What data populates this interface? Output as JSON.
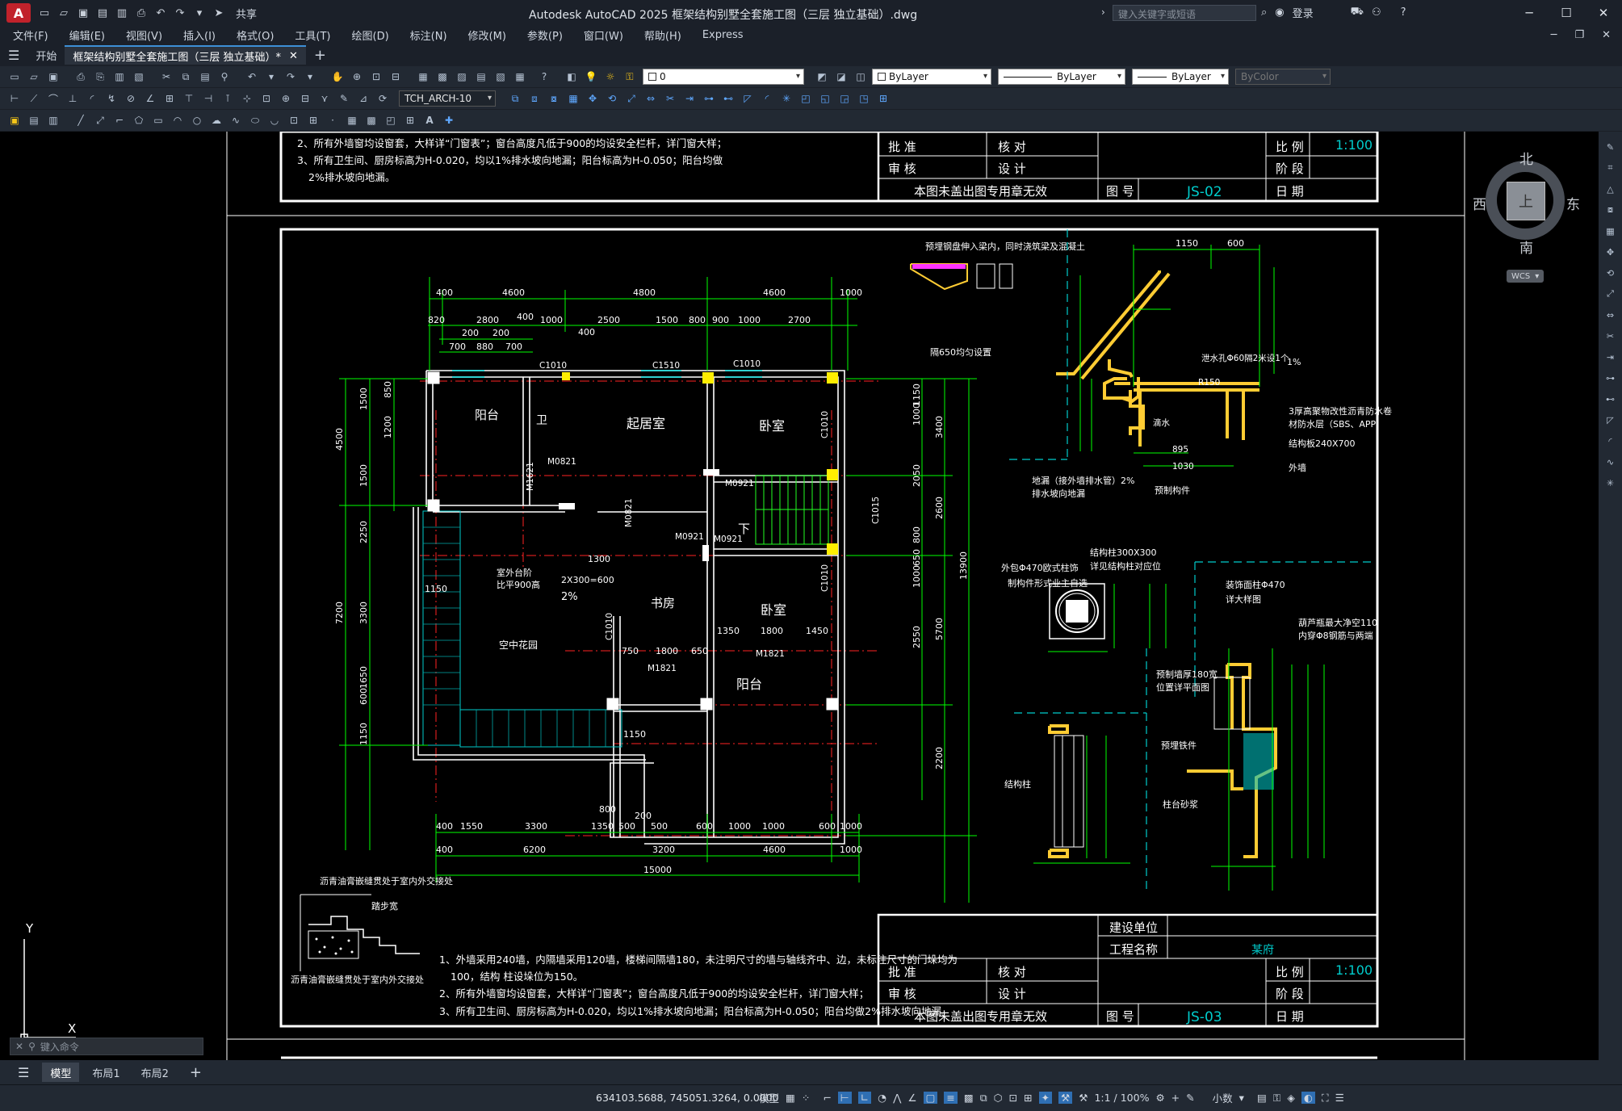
{
  "title_bar": {
    "app_button": "A",
    "share_label": "共享",
    "window_title": "Autodesk AutoCAD 2025    框架结构别墅全套施工图（三层 独立基础）.dwg",
    "search_placeholder": "键入关键字或短语",
    "login_label": "登录"
  },
  "menu": {
    "items": [
      "文件(F)",
      "编辑(E)",
      "视图(V)",
      "插入(I)",
      "格式(O)",
      "工具(T)",
      "绘图(D)",
      "标注(N)",
      "修改(M)",
      "参数(P)",
      "窗口(W)",
      "帮助(H)",
      "Express"
    ]
  },
  "tabs": {
    "start": "开始",
    "doc": "框架结构别墅全套施工图（三层 独立基础）*"
  },
  "toolbar": {
    "layer_value": "0",
    "color_value": "ByLayer",
    "linetype_value": "ByLayer",
    "lineweight_value": "ByLayer",
    "plotstyle_value": "ByColor",
    "textstyle_value": "TCH_ARCH-10"
  },
  "viewcube": {
    "north": "北",
    "south": "南",
    "east": "东",
    "west": "西",
    "face": "上",
    "wcs": "WCS"
  },
  "drawing": {
    "notes_top": [
      "2、所有外墙窗均设窗套，大样详“门窗表”；窗台高度凡低于900的均设安全栏杆，详门窗大样；",
      "3、所有卫生间、厨房标高为H-0.020，均以1%排水坡向地漏；阳台标高为H-0.050；阳台均做",
      "2%排水坡向地漏。"
    ],
    "title_block_top": {
      "approve": "批  准",
      "check": "核  对",
      "review": "审  核",
      "design": "设  计",
      "scale_label": "比  例",
      "scale": "1:100",
      "stage_label": "阶  段",
      "stamp_note": "本图未盖出图专用章无效",
      "drawing_no_label": "图  号",
      "drawing_no": "JS-02",
      "date_label": "日  期"
    },
    "title_block_bottom": {
      "owner_label": "建设单位",
      "project_label": "工程名称",
      "project": "某府",
      "approve": "批  准",
      "check": "核  对",
      "review": "审  核",
      "design": "设  计",
      "scale_label": "比  例",
      "scale": "1:100",
      "stage_label": "阶  段",
      "stamp_note": "本图未盖出图专用章无效",
      "drawing_no_label": "图  号",
      "drawing_no": "JS-03",
      "date_label": "日  期"
    },
    "rooms": [
      "阳台",
      "卫",
      "起居室",
      "卧室",
      "书房",
      "卧室",
      "阳台",
      "空中花园",
      "下"
    ],
    "dims_top_row1": [
      "400",
      "4600",
      "4800",
      "4600",
      "1000"
    ],
    "dims_top_row2": [
      "820",
      "2800",
      "400",
      "1000",
      "2500",
      "1500",
      "800",
      "900",
      "1000",
      "2700"
    ],
    "dims_top_row3": [
      "700",
      "880",
      "700",
      "200",
      "200",
      "400"
    ],
    "dims_bottom_row1": [
      "400",
      "1550",
      "3300",
      "1350",
      "500",
      "200",
      "500",
      "600",
      "1000",
      "1000",
      "600",
      "1000"
    ],
    "dims_bottom_row2": [
      "400",
      "6200",
      "3200",
      "4600",
      "1000"
    ],
    "dims_bottom_total": "15000",
    "dims_left": [
      "4500",
      "7200",
      "2250",
      "3300",
      "1650",
      "1150",
      "1500",
      "1200",
      "1500",
      "850",
      "600"
    ],
    "dims_right": [
      "1150",
      "3400",
      "2050",
      "2600",
      "5700",
      "13900",
      "2550",
      "2200",
      "1000",
      "800",
      "650",
      "1000"
    ],
    "tags": [
      "C1010",
      "C1510",
      "C1010",
      "M0821",
      "M1621",
      "M0921",
      "M0921",
      "C1010",
      "C1015",
      "M0821",
      "C1010",
      "C1010",
      "M1821",
      "M1821",
      "M0921"
    ],
    "misc_labels": [
      "室外台阶",
      "比平900高",
      "2X300=600",
      "1300",
      "2%",
      "1150",
      "1150",
      "1350",
      "1800",
      "1450",
      "750",
      "1800",
      "650",
      "800"
    ],
    "detail_notes": [
      "预埋钢盘伸入梁内，同时浇筑梁及混凝土",
      "隔650均匀设置",
      "1150",
      "600",
      "3厚高聚物改性沥青防水卷",
      "材防水层（SBS、APP）",
      "结构板240X700",
      "外墙",
      "地漏（接外墙排水管）2%",
      "排水坡向地漏",
      "预制构件",
      "泄水孔Φ60隔2米设1个",
      "1%",
      "R150",
      "滴水",
      "895",
      "1030",
      "结构柱300X300",
      "详见结构柱对应位",
      "外包Φ470欧式柱饰",
      "制构件形式业主自选",
      "装饰面柱Φ470",
      "详大样图",
      "葫芦瓶最大净空110",
      "内穿Φ8钢筋与两端",
      "预制墙厚180宽",
      "位置详平面图",
      "预埋铁件",
      "柱台砂浆",
      "结构柱"
    ],
    "notes_bottom": [
      "1、外墙采用240墙，内隔墙采用120墙，楼梯间隔墙180，未注明尺寸的墙与轴线齐中、边，未标注尺寸的门垛均为",
      "100，结构 柱设垛位为150。",
      "2、所有外墙窗均设窗套，大样详“门窗表”；窗台高度凡低于900的均设安全栏杆，详门窗大样；",
      "3、所有卫生间、厨房标高为H-0.020，均以1%排水坡向地漏；阳台标高为H-0.050；阳台均做2%排水坡向地漏。"
    ],
    "step_notes": [
      "沥青油膏嵌缝贯处于室内外交接处",
      "踏步宽",
      "沥青油膏嵌缝贯处于室内外交接处"
    ],
    "cmd_placeholder": "键入命令"
  },
  "layout_tabs": [
    "模型",
    "布局1",
    "布局2"
  ],
  "status": {
    "coordinates": "634103.5688, 745051.3264, 0.0000",
    "model_label": "模型",
    "scale": "1:1 / 100%",
    "units": "小数"
  },
  "colors": {
    "dim_green": "#00ff00",
    "axis_red": "#ff0000",
    "wall_white": "#ffffff",
    "detail_yellow": "#ffcc33",
    "cyan": "#00cccc",
    "accent": "#3d8fd6"
  }
}
